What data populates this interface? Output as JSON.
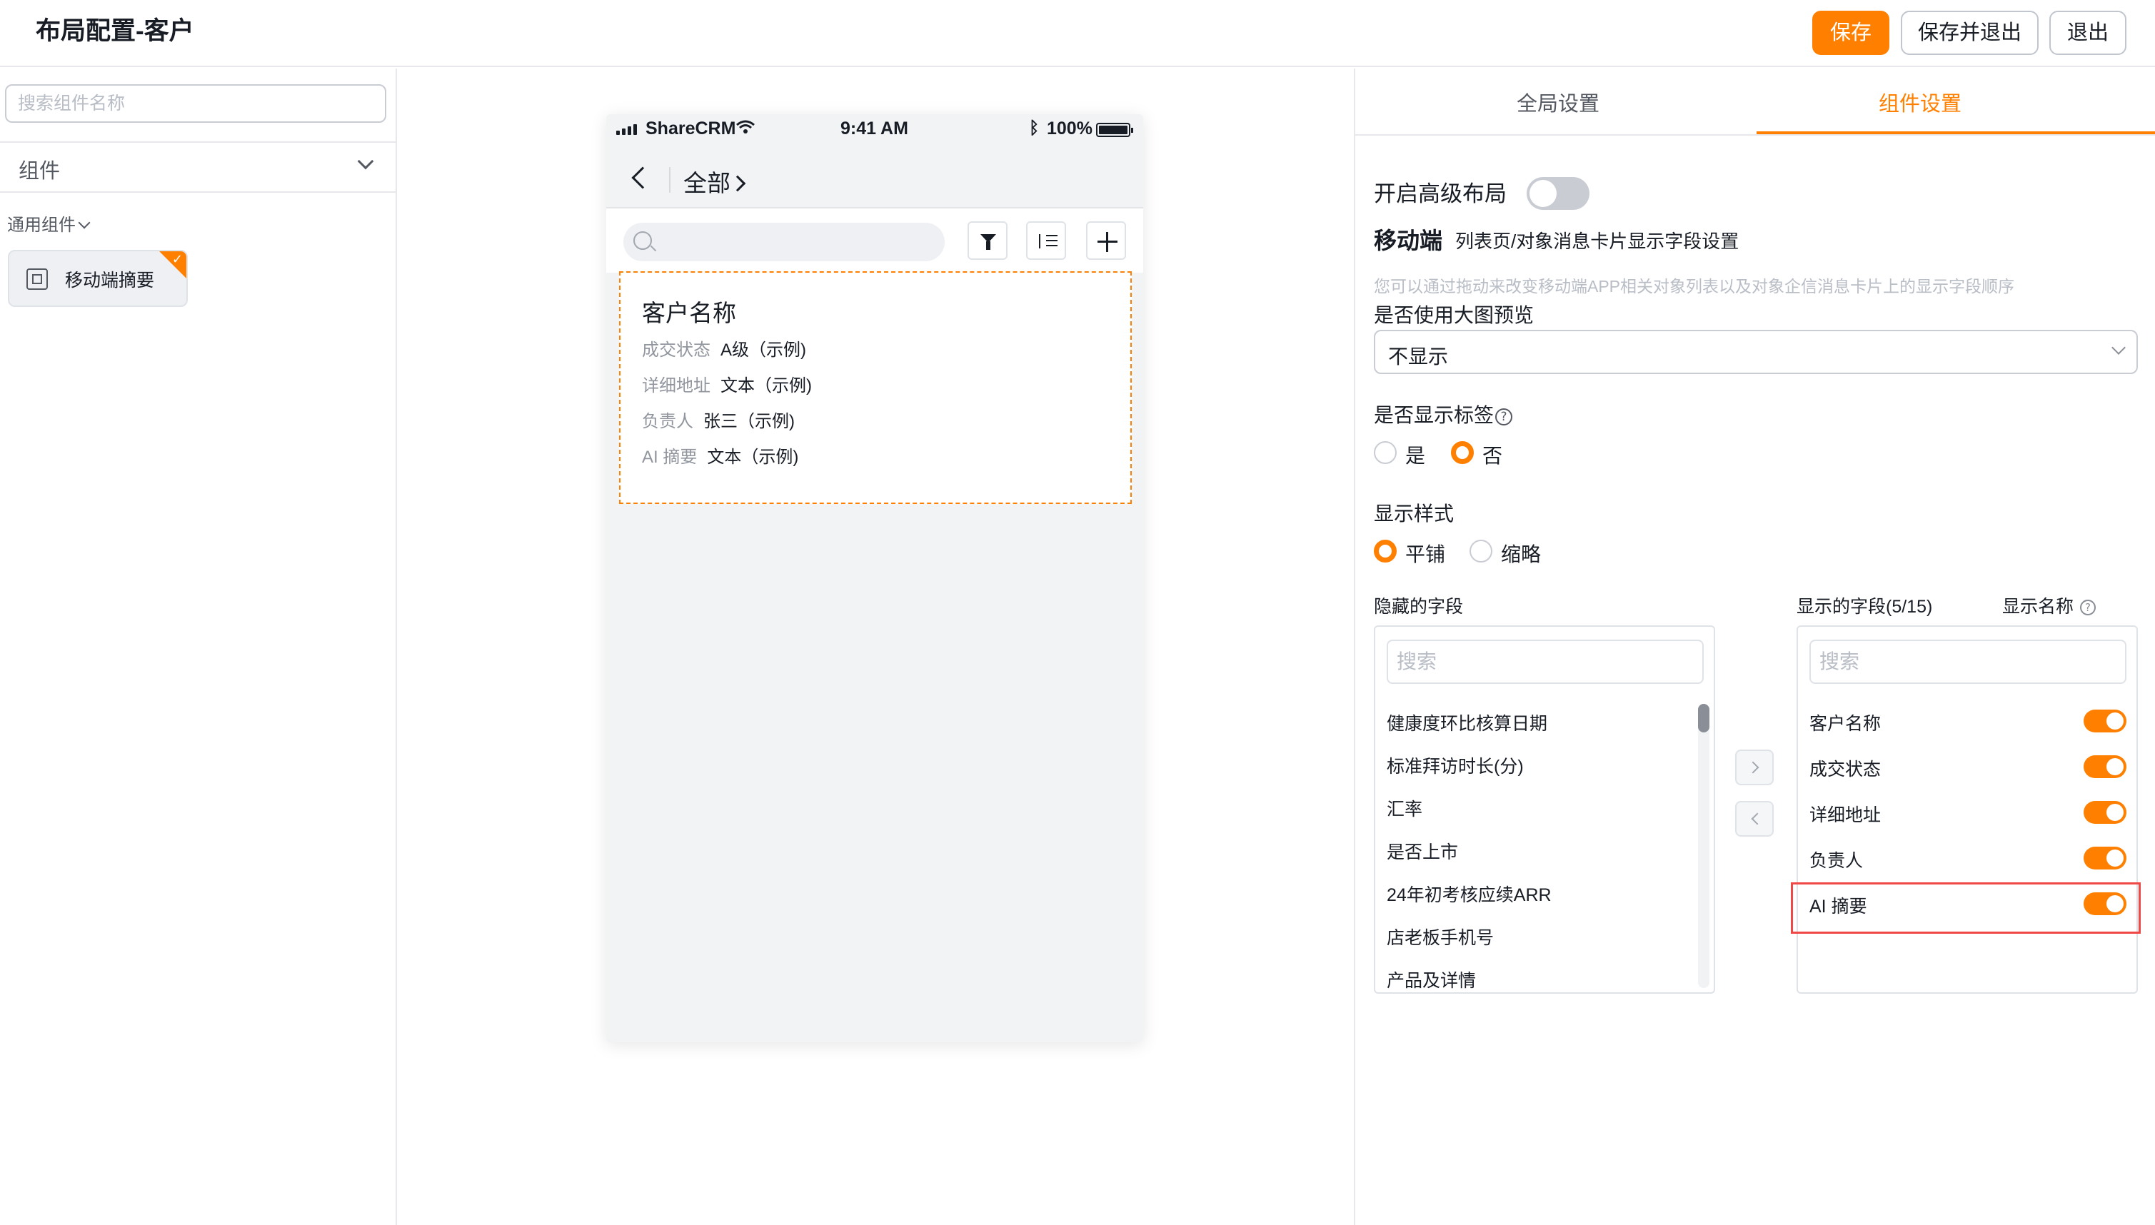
{
  "header": {
    "title": "布局配置-客户",
    "save_label": "保存",
    "save_exit_label": "保存并退出",
    "exit_label": "退出"
  },
  "left_panel": {
    "search_placeholder": "搜索组件名称",
    "select_label": "组件",
    "group_title": "通用组件",
    "component_label": "移动端摘要"
  },
  "phone": {
    "carrier": "ShareCRM",
    "time": "9:41 AM",
    "battery": "100%",
    "nav_title": "全部",
    "card": {
      "title": "客户名称",
      "rows": [
        {
          "key": "成交状态",
          "value": "A级（示例)"
        },
        {
          "key": "详细地址",
          "value": "文本（示例)"
        },
        {
          "key": "负责人",
          "value": "张三（示例)"
        },
        {
          "key": "AI 摘要",
          "value": "文本（示例)"
        }
      ]
    }
  },
  "right_panel": {
    "tabs": [
      "全局设置",
      "组件设置"
    ],
    "active_tab": "组件设置",
    "advanced_layout_label": "开启高级布局",
    "advanced_layout_on": false,
    "mobile_heading": "移动端",
    "mobile_subtitle": "列表页/对象消息卡片显示字段设置",
    "hint": "您可以通过拖动来改变移动端APP相关对象列表以及对象企信消息卡片上的显示字段顺序",
    "large_preview_label": "是否使用大图预览",
    "large_preview_value": "不显示",
    "show_tags_label": "是否显示标签",
    "show_tags_options": [
      "是",
      "否"
    ],
    "show_tags_selected": "否",
    "display_style_label": "显示样式",
    "display_style_options": [
      "平铺",
      "缩略"
    ],
    "display_style_selected": "平铺",
    "hidden_fields_label": "隐藏的字段",
    "shown_fields_label": "显示的字段(5/15)",
    "show_name_label": "显示名称",
    "search_placeholder": "搜索",
    "hidden_fields": [
      "健康度环比核算日期",
      "标准拜访时长(分)",
      "汇率",
      "是否上市",
      "24年初考核应续ARR",
      "店老板手机号",
      "产品及详情"
    ],
    "shown_fields": [
      {
        "label": "客户名称",
        "show_name": true
      },
      {
        "label": "成交状态",
        "show_name": true
      },
      {
        "label": "详细地址",
        "show_name": true
      },
      {
        "label": "负责人",
        "show_name": true
      },
      {
        "label": "AI 摘要",
        "show_name": true
      }
    ]
  },
  "colors": {
    "accent": "#ff8000",
    "highlight_frame": "#f04747"
  }
}
